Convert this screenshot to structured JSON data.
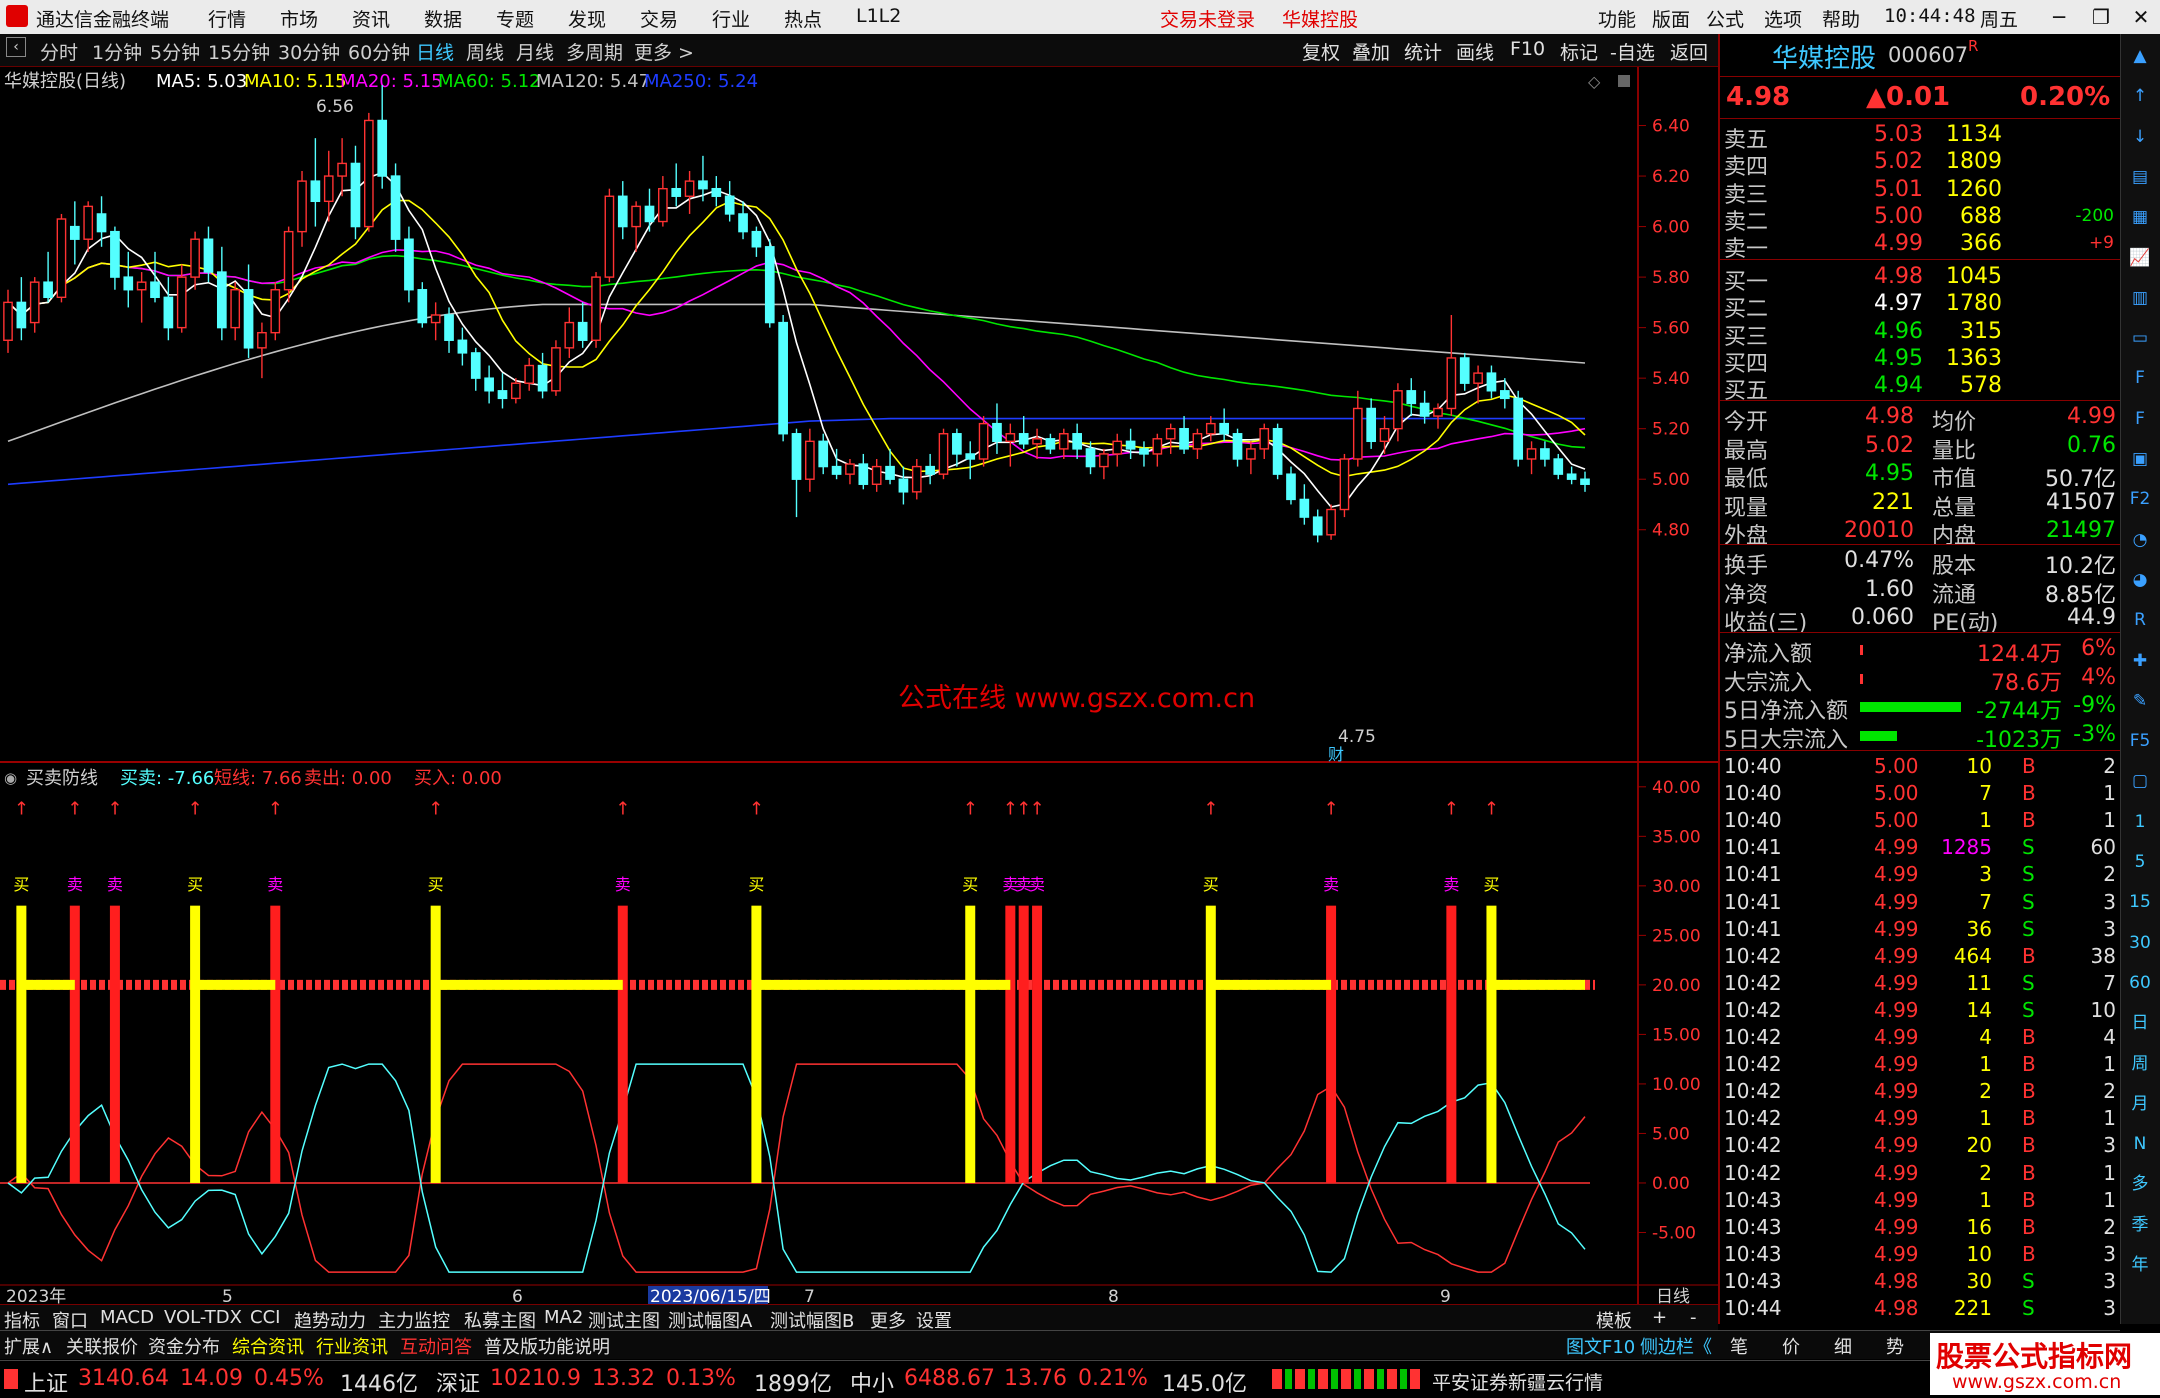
{
  "app": {
    "title": "通达信金融终端",
    "menu": [
      "行情",
      "市场",
      "资讯",
      "数据",
      "专题",
      "发现",
      "交易",
      "行业",
      "热点",
      "L1L2"
    ],
    "login_status": "交易未登录",
    "stock_title": "华媒控股",
    "right_menu": [
      "功能",
      "版面",
      "公式",
      "选项",
      "帮助"
    ],
    "time": "10:44:48",
    "weekday": "周五"
  },
  "periods": [
    "分时",
    "1分钟",
    "5分钟",
    "15分钟",
    "30分钟",
    "60分钟",
    "日线",
    "周线",
    "月线",
    "多周期",
    "更多 >"
  ],
  "active_period": "日线",
  "chart_tools": [
    "复权",
    "叠加",
    "统计",
    "画线",
    "F10",
    "标记",
    "-自选",
    "返回"
  ],
  "kline": {
    "header": {
      "name": "华媒控股(日线)",
      "ma5": "MA5: 5.03",
      "ma10": "MA10: 5.15",
      "ma20": "MA20: 5.15",
      "ma60": "MA60: 5.12",
      "ma120": "MA120: 5.47",
      "ma250": "MA250: 5.24"
    },
    "high_label": "6.56",
    "low_label": "4.75",
    "cai_tag": "财",
    "watermark": "公式在线  www.gszx.com.cn",
    "price_ticks": [
      "6.40",
      "6.20",
      "6.00",
      "5.80",
      "5.60",
      "5.40",
      "5.20",
      "5.00",
      "4.80"
    ]
  },
  "indicator": {
    "name": "买卖防线",
    "maimai": "买卖: -7.66",
    "duanxian": "短线: 7.66",
    "maichu": "卖出: 0.00",
    "mairu": "买入: 0.00",
    "ticks": [
      "40.00",
      "35.00",
      "30.00",
      "25.00",
      "20.00",
      "15.00",
      "10.00",
      "5.00",
      "0.00",
      "-5.00"
    ],
    "buy_label": "买",
    "sell_label": "卖"
  },
  "chart_data": {
    "type": "candlestick",
    "price_axis": [
      4.7,
      6.6
    ],
    "candles": [
      [
        5.55,
        5.75,
        5.5,
        5.7
      ],
      [
        5.7,
        5.8,
        5.55,
        5.6
      ],
      [
        5.62,
        5.8,
        5.58,
        5.78
      ],
      [
        5.78,
        5.9,
        5.7,
        5.72
      ],
      [
        5.72,
        6.05,
        5.7,
        6.03
      ],
      [
        6.0,
        6.1,
        5.85,
        5.95
      ],
      [
        5.95,
        6.1,
        5.9,
        6.08
      ],
      [
        6.05,
        6.12,
        5.92,
        5.98
      ],
      [
        5.98,
        6.0,
        5.75,
        5.8
      ],
      [
        5.8,
        5.9,
        5.68,
        5.75
      ],
      [
        5.75,
        5.82,
        5.62,
        5.78
      ],
      [
        5.78,
        5.9,
        5.7,
        5.72
      ],
      [
        5.72,
        5.8,
        5.55,
        5.6
      ],
      [
        5.6,
        5.85,
        5.58,
        5.8
      ],
      [
        5.8,
        5.98,
        5.75,
        5.95
      ],
      [
        5.95,
        6.0,
        5.78,
        5.82
      ],
      [
        5.82,
        5.92,
        5.55,
        5.6
      ],
      [
        5.6,
        5.78,
        5.55,
        5.75
      ],
      [
        5.75,
        5.85,
        5.48,
        5.52
      ],
      [
        5.52,
        5.62,
        5.4,
        5.58
      ],
      [
        5.58,
        5.78,
        5.55,
        5.75
      ],
      [
        5.75,
        6.0,
        5.7,
        5.98
      ],
      [
        5.98,
        6.22,
        5.92,
        6.18
      ],
      [
        6.18,
        6.35,
        6.0,
        6.1
      ],
      [
        6.1,
        6.3,
        6.02,
        6.2
      ],
      [
        6.2,
        6.35,
        6.12,
        6.25
      ],
      [
        6.25,
        6.32,
        5.95,
        6.0
      ],
      [
        6.0,
        6.45,
        5.98,
        6.42
      ],
      [
        6.42,
        6.56,
        6.15,
        6.2
      ],
      [
        6.2,
        6.25,
        5.9,
        5.95
      ],
      [
        5.95,
        6.0,
        5.7,
        5.75
      ],
      [
        5.75,
        5.78,
        5.6,
        5.62
      ],
      [
        5.62,
        5.7,
        5.55,
        5.65
      ],
      [
        5.65,
        5.68,
        5.5,
        5.55
      ],
      [
        5.55,
        5.6,
        5.45,
        5.5
      ],
      [
        5.5,
        5.52,
        5.35,
        5.4
      ],
      [
        5.4,
        5.45,
        5.3,
        5.35
      ],
      [
        5.35,
        5.42,
        5.28,
        5.32
      ],
      [
        5.32,
        5.4,
        5.3,
        5.38
      ],
      [
        5.38,
        5.48,
        5.35,
        5.45
      ],
      [
        5.45,
        5.5,
        5.32,
        5.35
      ],
      [
        5.35,
        5.55,
        5.33,
        5.52
      ],
      [
        5.52,
        5.68,
        5.48,
        5.62
      ],
      [
        5.62,
        5.7,
        5.52,
        5.55
      ],
      [
        5.55,
        5.82,
        5.52,
        5.8
      ],
      [
        5.8,
        6.15,
        5.78,
        6.12
      ],
      [
        6.12,
        6.18,
        5.95,
        6.0
      ],
      [
        6.0,
        6.1,
        5.9,
        6.08
      ],
      [
        6.08,
        6.15,
        5.98,
        6.02
      ],
      [
        6.02,
        6.2,
        6.0,
        6.15
      ],
      [
        6.15,
        6.25,
        6.08,
        6.12
      ],
      [
        6.12,
        6.22,
        6.05,
        6.18
      ],
      [
        6.18,
        6.28,
        6.1,
        6.15
      ],
      [
        6.15,
        6.2,
        6.08,
        6.12
      ],
      [
        6.12,
        6.18,
        6.02,
        6.05
      ],
      [
        6.05,
        6.1,
        5.95,
        5.98
      ],
      [
        5.98,
        6.0,
        5.88,
        5.92
      ],
      [
        5.92,
        5.95,
        5.6,
        5.62
      ],
      [
        5.62,
        5.65,
        5.15,
        5.18
      ],
      [
        5.18,
        5.2,
        4.85,
        5.0
      ],
      [
        5.0,
        5.2,
        4.95,
        5.15
      ],
      [
        5.15,
        5.18,
        5.02,
        5.05
      ],
      [
        5.05,
        5.12,
        5.0,
        5.02
      ],
      [
        5.02,
        5.08,
        4.98,
        5.06
      ],
      [
        5.06,
        5.1,
        4.96,
        4.98
      ],
      [
        4.98,
        5.08,
        4.95,
        5.05
      ],
      [
        5.05,
        5.12,
        4.98,
        5.0
      ],
      [
        5.0,
        5.05,
        4.9,
        4.95
      ],
      [
        4.95,
        5.08,
        4.92,
        5.05
      ],
      [
        5.05,
        5.1,
        4.98,
        5.02
      ],
      [
        5.02,
        5.2,
        5.0,
        5.18
      ],
      [
        5.18,
        5.2,
        5.05,
        5.1
      ],
      [
        5.1,
        5.15,
        5.0,
        5.08
      ],
      [
        5.08,
        5.25,
        5.05,
        5.22
      ],
      [
        5.22,
        5.3,
        5.1,
        5.15
      ],
      [
        5.15,
        5.22,
        5.05,
        5.18
      ],
      [
        5.18,
        5.25,
        5.12,
        5.14
      ],
      [
        5.14,
        5.2,
        5.08,
        5.16
      ],
      [
        5.16,
        5.18,
        5.1,
        5.12
      ],
      [
        5.12,
        5.2,
        5.08,
        5.18
      ],
      [
        5.18,
        5.22,
        5.08,
        5.12
      ],
      [
        5.12,
        5.15,
        5.02,
        5.05
      ],
      [
        5.05,
        5.12,
        5.0,
        5.1
      ],
      [
        5.1,
        5.18,
        5.05,
        5.15
      ],
      [
        5.15,
        5.2,
        5.08,
        5.12
      ],
      [
        5.12,
        5.15,
        5.05,
        5.1
      ],
      [
        5.1,
        5.18,
        5.05,
        5.16
      ],
      [
        5.16,
        5.22,
        5.1,
        5.2
      ],
      [
        5.2,
        5.25,
        5.1,
        5.12
      ],
      [
        5.12,
        5.2,
        5.08,
        5.18
      ],
      [
        5.18,
        5.25,
        5.15,
        5.22
      ],
      [
        5.22,
        5.28,
        5.15,
        5.18
      ],
      [
        5.18,
        5.2,
        5.05,
        5.08
      ],
      [
        5.08,
        5.15,
        5.02,
        5.12
      ],
      [
        5.12,
        5.22,
        5.08,
        5.2
      ],
      [
        5.2,
        5.22,
        5.0,
        5.02
      ],
      [
        5.02,
        5.05,
        4.9,
        4.92
      ],
      [
        4.92,
        4.98,
        4.82,
        4.85
      ],
      [
        4.85,
        4.88,
        4.75,
        4.78
      ],
      [
        4.78,
        4.9,
        4.76,
        4.88
      ],
      [
        4.88,
        5.1,
        4.85,
        5.08
      ],
      [
        5.08,
        5.35,
        5.05,
        5.28
      ],
      [
        5.28,
        5.32,
        5.12,
        5.15
      ],
      [
        5.15,
        5.25,
        5.1,
        5.2
      ],
      [
        5.2,
        5.38,
        5.15,
        5.35
      ],
      [
        5.35,
        5.4,
        5.25,
        5.3
      ],
      [
        5.3,
        5.35,
        5.22,
        5.25
      ],
      [
        5.25,
        5.3,
        5.2,
        5.28
      ],
      [
        5.28,
        5.65,
        5.25,
        5.48
      ],
      [
        5.48,
        5.5,
        5.35,
        5.38
      ],
      [
        5.38,
        5.45,
        5.3,
        5.42
      ],
      [
        5.42,
        5.45,
        5.32,
        5.35
      ],
      [
        5.35,
        5.4,
        5.28,
        5.32
      ],
      [
        5.32,
        5.35,
        5.05,
        5.08
      ],
      [
        5.08,
        5.15,
        5.02,
        5.12
      ],
      [
        5.12,
        5.15,
        5.05,
        5.08
      ],
      [
        5.08,
        5.1,
        5.0,
        5.02
      ],
      [
        5.02,
        5.05,
        4.98,
        5.0
      ],
      [
        5.0,
        5.03,
        4.95,
        4.98
      ]
    ],
    "buy_markers": [
      1,
      14,
      32,
      56,
      72,
      90,
      111
    ],
    "sell_markers": [
      5,
      8,
      20,
      46,
      75,
      76,
      77,
      99,
      108
    ],
    "indicator_axis": [
      -10,
      42
    ]
  },
  "quote": {
    "name": "华媒控股",
    "code": "000607",
    "r_tag": "R",
    "price": "4.98",
    "change": "▲0.01",
    "pct": "0.20%",
    "asks": [
      {
        "label": "卖五",
        "price": "5.03",
        "vol": "1134",
        "delta": ""
      },
      {
        "label": "卖四",
        "price": "5.02",
        "vol": "1809",
        "delta": ""
      },
      {
        "label": "卖三",
        "price": "5.01",
        "vol": "1260",
        "delta": ""
      },
      {
        "label": "卖二",
        "price": "5.00",
        "vol": "688",
        "delta": "-200"
      },
      {
        "label": "卖一",
        "price": "4.99",
        "vol": "366",
        "delta": "+9"
      }
    ],
    "bids": [
      {
        "label": "买一",
        "price": "4.98",
        "vol": "1045"
      },
      {
        "label": "买二",
        "price": "4.97",
        "vol": "1780"
      },
      {
        "label": "买三",
        "price": "4.96",
        "vol": "315"
      },
      {
        "label": "买四",
        "price": "4.95",
        "vol": "1363"
      },
      {
        "label": "买五",
        "price": "4.94",
        "vol": "578"
      }
    ],
    "stats1": [
      [
        "今开",
        "4.98",
        "均价",
        "4.99"
      ],
      [
        "最高",
        "5.02",
        "量比",
        "0.76"
      ],
      [
        "最低",
        "4.95",
        "市值",
        "50.7亿"
      ],
      [
        "现量",
        "221",
        "总量",
        "41507"
      ],
      [
        "外盘",
        "20010",
        "内盘",
        "21497"
      ]
    ],
    "stats2": [
      [
        "换手",
        "0.47%",
        "股本",
        "10.2亿"
      ],
      [
        "净资",
        "1.60",
        "流通",
        "8.85亿"
      ],
      [
        "收益(三)",
        "0.060",
        "PE(动)",
        "44.9"
      ]
    ],
    "flows": [
      {
        "label": "净流入额",
        "value": "124.4万",
        "pct": "6%",
        "bar": 0.02
      },
      {
        "label": "大宗流入",
        "value": "78.6万",
        "pct": "4%",
        "bar": 0.02
      },
      {
        "label": "5日净流入额",
        "value": "-2744万",
        "pct": "-9%",
        "bar": 0.95
      },
      {
        "label": "5日大宗流入",
        "value": "-1023万",
        "pct": "-3%",
        "bar": 0.35
      }
    ],
    "ticks": [
      [
        "10:40",
        "5.00",
        "10",
        "B",
        "2"
      ],
      [
        "10:40",
        "5.00",
        "7",
        "B",
        "1"
      ],
      [
        "10:40",
        "5.00",
        "1",
        "B",
        "1"
      ],
      [
        "10:41",
        "4.99",
        "1285",
        "S",
        "60"
      ],
      [
        "10:41",
        "4.99",
        "3",
        "S",
        "2"
      ],
      [
        "10:41",
        "4.99",
        "7",
        "S",
        "3"
      ],
      [
        "10:41",
        "4.99",
        "36",
        "S",
        "3"
      ],
      [
        "10:42",
        "4.99",
        "464",
        "B",
        "38"
      ],
      [
        "10:42",
        "4.99",
        "11",
        "S",
        "7"
      ],
      [
        "10:42",
        "4.99",
        "14",
        "S",
        "10"
      ],
      [
        "10:42",
        "4.99",
        "4",
        "B",
        "4"
      ],
      [
        "10:42",
        "4.99",
        "1",
        "B",
        "1"
      ],
      [
        "10:42",
        "4.99",
        "2",
        "B",
        "2"
      ],
      [
        "10:42",
        "4.99",
        "1",
        "B",
        "1"
      ],
      [
        "10:42",
        "4.99",
        "20",
        "B",
        "3"
      ],
      [
        "10:42",
        "4.99",
        "2",
        "B",
        "1"
      ],
      [
        "10:43",
        "4.99",
        "1",
        "B",
        "1"
      ],
      [
        "10:43",
        "4.99",
        "16",
        "B",
        "2"
      ],
      [
        "10:43",
        "4.99",
        "10",
        "B",
        "3"
      ],
      [
        "10:43",
        "4.98",
        "30",
        "S",
        "3"
      ],
      [
        "10:44",
        "4.98",
        "221",
        "S",
        "3"
      ]
    ]
  },
  "date_axis": [
    "2023年",
    "5",
    "6",
    "2023/06/15/四",
    "7",
    "8",
    "9"
  ],
  "date_axis_right": "日线",
  "tabs1": [
    "指标",
    "窗口",
    "MACD",
    "VOL-TDX",
    "CCI",
    "趋势动力",
    "主力监控",
    "私募主图",
    "MA2",
    "测试主图",
    "测试幅图A",
    "测试幅图B",
    "更多",
    "设置"
  ],
  "tabs1_right": [
    "模板",
    "+",
    "-"
  ],
  "tabs2": [
    "扩展∧",
    "关联报价",
    "资金分布",
    "综合资讯",
    "行业资讯",
    "互动问答",
    "普及版功能说明"
  ],
  "tabs2_right": [
    "图文F10",
    "侧边栏《",
    "笔",
    "价",
    "细",
    "势"
  ],
  "status": {
    "sh": [
      "上证",
      "3140.64",
      "14.09",
      "0.45%",
      "1446亿"
    ],
    "sz": [
      "深证",
      "10210.9",
      "13.32",
      "0.13%",
      "1899亿"
    ],
    "zx": [
      "中小",
      "6488.67",
      "13.76",
      "0.21%",
      "145.0亿"
    ],
    "broker": "平安证券新疆云行情",
    "site_name": "股票公式指标网",
    "site_url": "www.gszx.com.cn"
  },
  "strip_icons": [
    "up-icon",
    "up-arrow-icon",
    "down-arrow-icon",
    "list-icon",
    "grid-icon",
    "chart-icon",
    "bars-icon",
    "doc-icon",
    "f10-icon",
    "f10b-icon",
    "book-icon",
    "f2-icon",
    "gauge-icon",
    "gauge2-icon",
    "rsi-icon",
    "cross-icon",
    "pen-icon",
    "fs-icon",
    "monitor-icon",
    "1",
    "5",
    "15",
    "30",
    "60",
    "日",
    "周",
    "月",
    "N",
    "多",
    "季",
    "年"
  ],
  "colors": {
    "up": "#ff3232",
    "down": "#54ffff",
    "ma5": "#ffffff",
    "ma10": "#ffff00",
    "ma20": "#ff00ff",
    "ma60": "#00e600",
    "ma120": "#c0c0c0",
    "ma250": "#1e3cff"
  }
}
